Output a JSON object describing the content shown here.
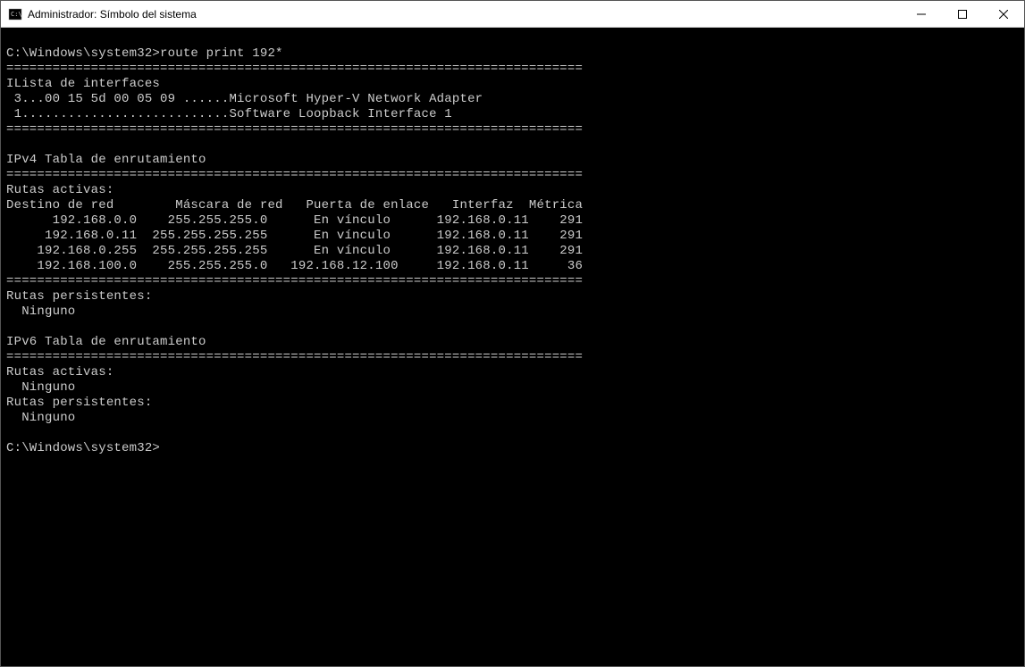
{
  "titlebar": {
    "title": "Administrador: Símbolo del sistema"
  },
  "console": {
    "prompt1": "C:\\Windows\\system32>",
    "command": "route print 192*",
    "sep": "===========================================================================",
    "iface_header": "ILista de interfaces",
    "iface_line1": " 3...00 15 5d 00 05 09 ......Microsoft Hyper-V Network Adapter",
    "iface_line2": " 1...........................Software Loopback Interface 1",
    "ipv4_title": "IPv4 Tabla de enrutamiento",
    "routes_active": "Rutas activas:",
    "routes_header": "Destino de red        Máscara de red   Puerta de enlace   Interfaz  Métrica",
    "route1": "      192.168.0.0    255.255.255.0      En vínculo      192.168.0.11    291",
    "route2": "     192.168.0.11  255.255.255.255      En vínculo      192.168.0.11    291",
    "route3": "    192.168.0.255  255.255.255.255      En vínculo      192.168.0.11    291",
    "route4": "    192.168.100.0    255.255.255.0   192.168.12.100     192.168.0.11     36",
    "routes_persist": "Rutas persistentes:",
    "none": "  Ninguno",
    "ipv6_title": "IPv6 Tabla de enrutamiento",
    "prompt2": "C:\\Windows\\system32>",
    "blank": ""
  }
}
